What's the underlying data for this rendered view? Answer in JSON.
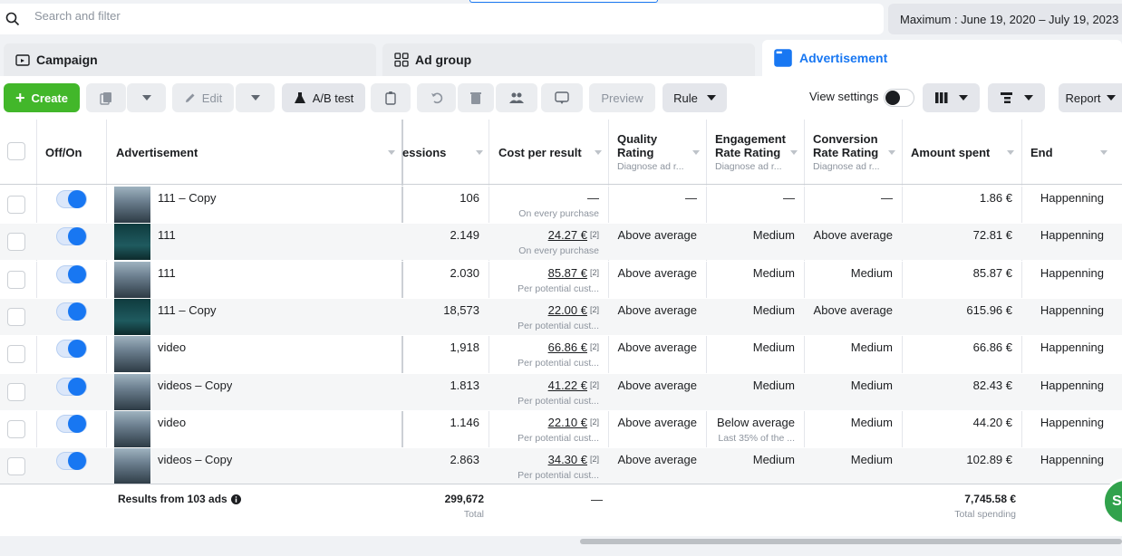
{
  "search": {
    "placeholder": "Search and filter"
  },
  "date_range": "Maximum : June 19, 2020 – July 19, 2023",
  "tabs": [
    {
      "label": "Campaign"
    },
    {
      "label": "Ad group"
    },
    {
      "label": "Advertisement"
    }
  ],
  "toolbar": {
    "create_label": "Create",
    "edit_label": "Edit",
    "ab_test_label": "A/B test",
    "preview_label": "Preview",
    "rule_label": "Rule",
    "view_settings_label": "View settings",
    "report_label": "Report"
  },
  "columns": {
    "off_on": "Off/On",
    "advertisement": "Advertisement",
    "impressions": "essions",
    "cost_per_result": "Cost per result",
    "quality": {
      "label": "Quality",
      "label2": "Rating",
      "sub": "Diagnose ad r..."
    },
    "engagement": {
      "label": "Engagement",
      "label2": "Rate Rating",
      "sub": "Diagnose ad r..."
    },
    "conversion": {
      "label": "Conversion",
      "label2": "Rate Rating",
      "sub": "Diagnose ad r..."
    },
    "amount_spent": "Amount spent",
    "end": "End"
  },
  "rows": [
    {
      "name": "111 – Copy",
      "thumb": "city",
      "impressions": "106",
      "cost": "—",
      "cost_sup": "",
      "cost_note": "On every purchase",
      "quality": "—",
      "engagement": "—",
      "engagement_note": "",
      "conversion": "—",
      "spent": "1.86 €",
      "end": "Happenning"
    },
    {
      "name": "111",
      "thumb": "promo",
      "impressions": "2.149",
      "cost": "24.27 €",
      "cost_sup": "[2]",
      "cost_note": "On every purchase",
      "quality": "Above average",
      "engagement": "Medium",
      "engagement_note": "",
      "conversion": "Above average",
      "spent": "72.81 €",
      "end": "Happenning"
    },
    {
      "name": "111",
      "thumb": "city",
      "impressions": "2.030",
      "cost": "85.87 €",
      "cost_sup": "[2]",
      "cost_note": "Per potential cust...",
      "quality": "Above average",
      "engagement": "Medium",
      "engagement_note": "",
      "conversion": "Medium",
      "spent": "85.87 €",
      "end": "Happenning"
    },
    {
      "name": "111 – Copy",
      "thumb": "promo",
      "impressions": "18,573",
      "cost": "22.00 €",
      "cost_sup": "[2]",
      "cost_note": "Per potential cust...",
      "quality": "Above average",
      "engagement": "Medium",
      "engagement_note": "",
      "conversion": "Above average",
      "spent": "615.96 €",
      "end": "Happenning"
    },
    {
      "name": "video",
      "thumb": "city",
      "impressions": "1,918",
      "cost": "66.86 €",
      "cost_sup": "[2]",
      "cost_note": "Per potential cust...",
      "quality": "Above average",
      "engagement": "Medium",
      "engagement_note": "",
      "conversion": "Medium",
      "spent": "66.86 €",
      "end": "Happenning"
    },
    {
      "name": "videos – Copy",
      "thumb": "city",
      "impressions": "1.813",
      "cost": "41.22 €",
      "cost_sup": "[2]",
      "cost_note": "Per potential cust...",
      "quality": "Above average",
      "engagement": "Medium",
      "engagement_note": "",
      "conversion": "Medium",
      "spent": "82.43 €",
      "end": "Happenning"
    },
    {
      "name": "video",
      "thumb": "city",
      "impressions": "1.146",
      "cost": "22.10 €",
      "cost_sup": "[2]",
      "cost_note": "Per potential cust...",
      "quality": "Above average",
      "engagement": "Below average",
      "engagement_note": "Last 35% of the ...",
      "conversion": "Medium",
      "spent": "44.20 €",
      "end": "Happenning"
    },
    {
      "name": "videos – Copy",
      "thumb": "city",
      "impressions": "2.863",
      "cost": "34.30 €",
      "cost_sup": "[2]",
      "cost_note": "Per potential cust...",
      "quality": "Above average",
      "engagement": "Medium",
      "engagement_note": "",
      "conversion": "Medium",
      "spent": "102.89 €",
      "end": "Happenning"
    }
  ],
  "footer": {
    "results_label": "Results from 103 ads",
    "impressions_total": "299,672",
    "impressions_note": "Total",
    "cost": "—",
    "spent_total": "7,745.58 €",
    "spent_note": "Total spending"
  },
  "chat_bubble_label": "S",
  "colors": {
    "brand_blue": "#1877f2",
    "create_green": "#42b72a",
    "chat_green": "#31a24c"
  }
}
